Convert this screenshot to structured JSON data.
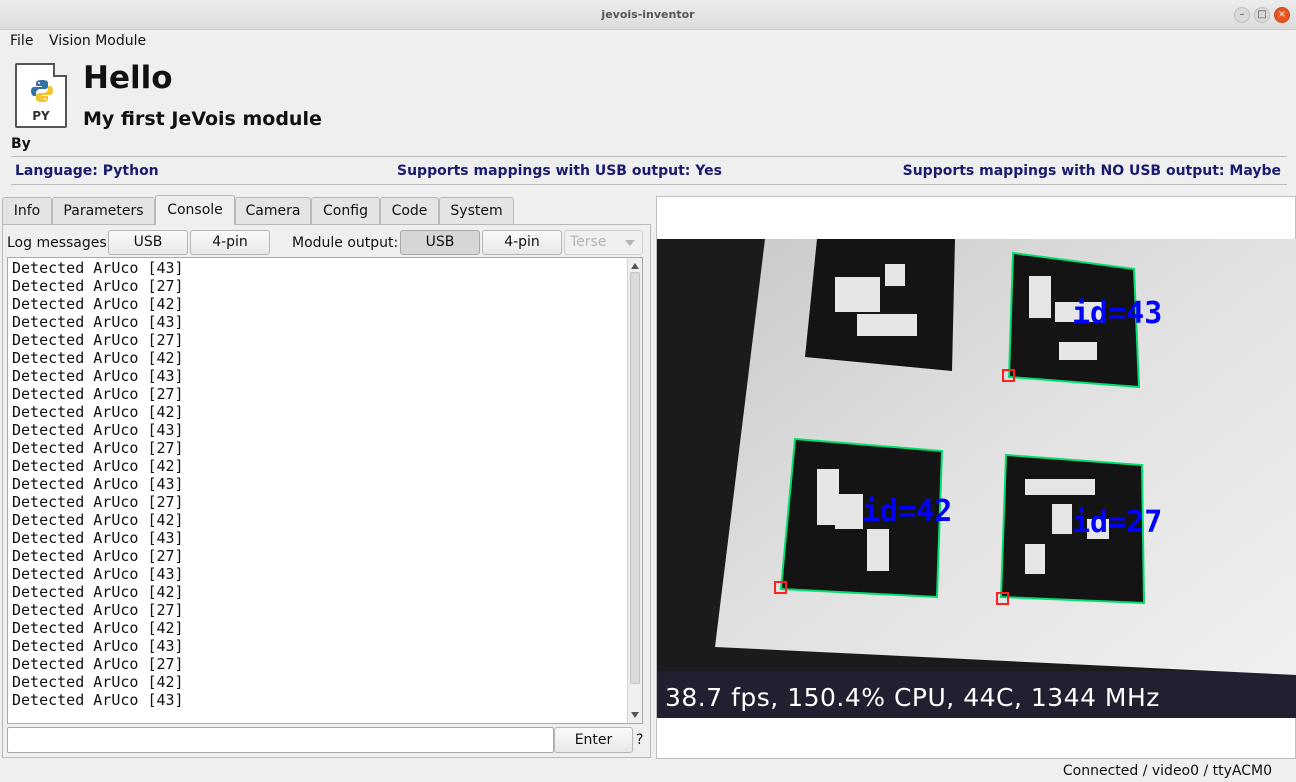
{
  "window": {
    "title": "jevois-inventor"
  },
  "menu": {
    "file": "File",
    "vision_module": "Vision Module"
  },
  "header": {
    "icon_ext": "PY",
    "module_name": "Hello",
    "description": "My first JeVois module",
    "by": "By",
    "language": "Language: Python",
    "usb_support": "Supports mappings with USB output: Yes",
    "nousb_support": "Supports mappings with NO USB output: Maybe"
  },
  "tabs": [
    "Info",
    "Parameters",
    "Console",
    "Camera",
    "Config",
    "Code",
    "System"
  ],
  "active_tab": "Console",
  "console": {
    "log_label": "Log messages:",
    "log_usb": "USB",
    "log_4pin": "4-pin",
    "output_label": "Module output:",
    "out_usb": "USB",
    "out_4pin": "4-pin",
    "verbosity": "Terse",
    "lines": [
      "Detected ArUco [43]",
      "Detected ArUco [27]",
      "Detected ArUco [42]",
      "Detected ArUco [43]",
      "Detected ArUco [27]",
      "Detected ArUco [42]",
      "Detected ArUco [43]",
      "Detected ArUco [27]",
      "Detected ArUco [42]",
      "Detected ArUco [43]",
      "Detected ArUco [27]",
      "Detected ArUco [42]",
      "Detected ArUco [43]",
      "Detected ArUco [27]",
      "Detected ArUco [42]",
      "Detected ArUco [43]",
      "Detected ArUco [27]",
      "Detected ArUco [43]",
      "Detected ArUco [42]",
      "Detected ArUco [27]",
      "Detected ArUco [42]",
      "Detected ArUco [43]",
      "Detected ArUco [27]",
      "Detected ArUco [42]",
      "Detected ArUco [43]"
    ],
    "command_value": "",
    "enter_label": "Enter",
    "help_label": "?"
  },
  "video": {
    "overlay": "38.7 fps, 150.4% CPU, 44C, 1344 MHz",
    "markers": [
      {
        "label": "id=43"
      },
      {
        "label": "id=42"
      },
      {
        "label": "id=27"
      }
    ],
    "marker_color": "#0000ff",
    "outline_color": "#00e070"
  },
  "status": {
    "connection": "Connected / video0 / ttyACM0"
  }
}
